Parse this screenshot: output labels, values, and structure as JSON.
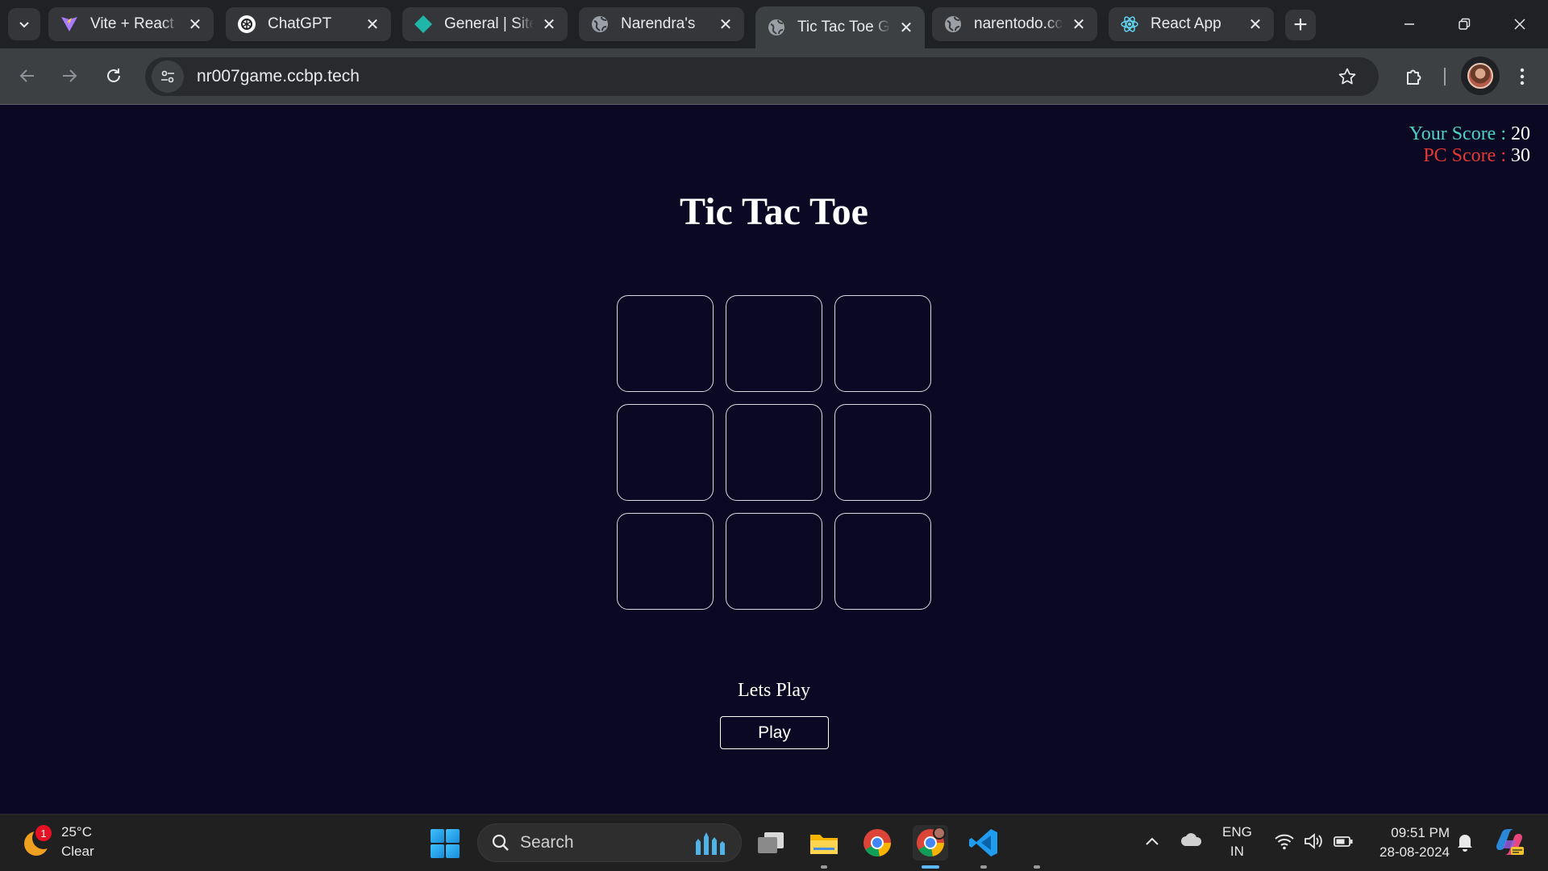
{
  "browser": {
    "tabs": [
      {
        "title": "Vite + React + TS",
        "icon": "vite-icon"
      },
      {
        "title": "ChatGPT",
        "icon": "chatgpt-icon"
      },
      {
        "title": "General | Site Settings",
        "icon": "site-diamond-icon"
      },
      {
        "title": "Narendra's",
        "icon": "globe-icon"
      },
      {
        "title": "Tic Tac Toe Game",
        "icon": "globe-icon",
        "active": true
      },
      {
        "title": "narentodo.ccbp.tech",
        "icon": "globe-icon"
      },
      {
        "title": "React App",
        "icon": "react-icon"
      }
    ],
    "url": "nr007game.ccbp.tech"
  },
  "game": {
    "your_score_label": "Your Score : ",
    "your_score": "20",
    "pc_score_label": "PC Score : ",
    "pc_score": "30",
    "title": "Tic Tac Toe",
    "board": [
      "",
      "",
      "",
      "",
      "",
      "",
      "",
      "",
      ""
    ],
    "status": "Lets Play",
    "play_label": "Play"
  },
  "taskbar": {
    "weather_temp": "25°C",
    "weather_desc": "Clear",
    "weather_badge": "1",
    "search_label": "Search",
    "lang_line1": "ENG",
    "lang_line2": "IN",
    "time": "09:51 PM",
    "date": "28-08-2024"
  },
  "colors": {
    "page_bg": "#0a0822",
    "your_score": "#4fd1c5",
    "pc_score": "#e53935"
  }
}
